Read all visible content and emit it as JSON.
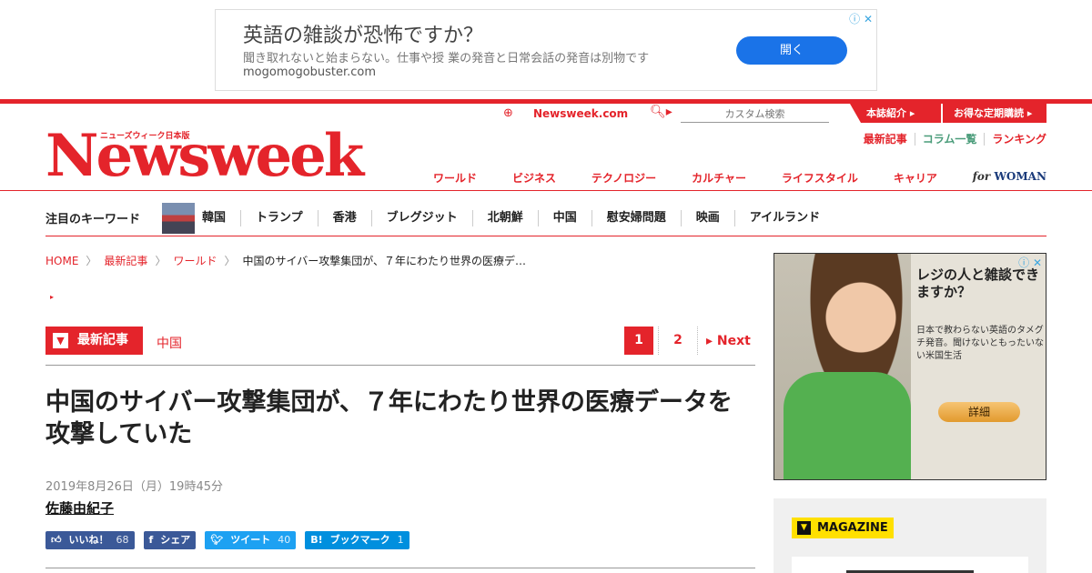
{
  "ad_top": {
    "headline": "英語の雑談が恐怖ですか？",
    "sub": "聞き取れないと始まらない。仕事や授 業の発音と日常会話の発音は別物です",
    "url": "mogomogobuster.com",
    "button": "開く"
  },
  "header": {
    "logo": "Newsweek",
    "logo_sub": "ニューズウィーク日本版",
    "site_link": "Newsweek.com",
    "search_placeholder": "カスタム検索",
    "tabs": [
      "本誌紹介",
      "お得な定期購読"
    ],
    "sublinks": [
      "最新記事",
      "コラム一覧",
      "ランキング"
    ],
    "categories": [
      "ワールド",
      "ビジネス",
      "テクノロジー",
      "カルチャー",
      "ライフスタイル",
      "キャリア"
    ],
    "for_woman": [
      "for",
      "WOMAN"
    ]
  },
  "keywords": {
    "label": "注目のキーワード",
    "items": [
      "韓国",
      "トランプ",
      "香港",
      "ブレグジット",
      "北朝鮮",
      "中国",
      "慰安婦問題",
      "映画",
      "アイルランド"
    ]
  },
  "breadcrumb": [
    "HOME",
    "最新記事",
    "ワールド",
    "中国のサイバー攻撃集団が、７年にわたり世界の医療デ…"
  ],
  "section": {
    "badge": "最新記事",
    "category": "中国",
    "pages": [
      "1",
      "2"
    ],
    "next": "Next"
  },
  "article": {
    "title": "中国のサイバー攻撃集団が、７年にわたり世界の医療データを攻撃していた",
    "date": "2019年8月26日（月）19時45分",
    "author": "佐藤由紀子"
  },
  "shares": [
    {
      "label": "いいね！",
      "count": "68"
    },
    {
      "label": "シェア",
      "count": ""
    },
    {
      "label": "ツイート",
      "count": "40"
    },
    {
      "label": "ブックマーク",
      "count": "1"
    }
  ],
  "ad_side": {
    "headline": "レジの人と雑談できますか？",
    "body": "日本で教わらない英語のタメグチ発音。聞けないともったいない米国生活",
    "button": "詳細"
  },
  "magazine": {
    "label": "MAGAZINE"
  },
  "colors": {
    "brand_red": "#e4242b",
    "fb": "#3b5998",
    "twitter": "#1da1f2",
    "hatena": "#008fde",
    "magazine_yellow": "#ffe000"
  }
}
